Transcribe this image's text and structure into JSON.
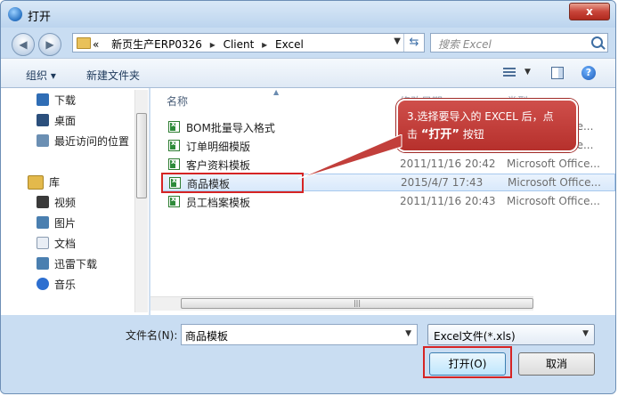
{
  "window": {
    "title": "打开",
    "close_label": "x"
  },
  "address": {
    "back_glyph": "◀",
    "forward_glyph": "▶",
    "prefix": "«",
    "crumbs": [
      "新页生产ERP0326",
      "Client",
      "Excel"
    ],
    "separator": "▸",
    "dropdown_glyph": "▼",
    "refresh_glyph": "⇆"
  },
  "search": {
    "placeholder": "搜索 Excel"
  },
  "toolbar": {
    "organize": "组织 ▾",
    "new_folder": "新建文件夹",
    "view_drop": "▼",
    "help": "?"
  },
  "sidebar": {
    "items": [
      {
        "label": "下载",
        "icon": "download-icon",
        "color": "#2f6db5"
      },
      {
        "label": "桌面",
        "icon": "desktop-icon",
        "color": "#2b4f7c"
      },
      {
        "label": "最近访问的位置",
        "icon": "recent-icon",
        "color": "#6b8fb3"
      }
    ],
    "library_label": "库",
    "library_items": [
      {
        "label": "视频",
        "icon": "video-icon",
        "color": "#3a3a3a"
      },
      {
        "label": "图片",
        "icon": "picture-icon",
        "color": "#4a7fb0"
      },
      {
        "label": "文档",
        "icon": "document-icon",
        "color": "#e9eef5"
      },
      {
        "label": "迅雷下载",
        "icon": "thunder-download-icon",
        "color": "#4a7fb0"
      },
      {
        "label": "音乐",
        "icon": "music-icon",
        "color": "#2d6fd0"
      }
    ]
  },
  "filelist": {
    "col_name": "名称",
    "sort_glyph": "▲",
    "col_date": "修改日期",
    "col_type": "类型",
    "scroll_grip": "|||",
    "rows": [
      {
        "name": "BOM批量导入格式",
        "date": "",
        "type": "",
        "selected": false
      },
      {
        "name": "订单明细模版",
        "date": "",
        "type": "",
        "selected": false
      },
      {
        "name": "客户资料模板",
        "date": "2011/11/16 20:42",
        "type": "Microsoft Office...",
        "selected": false
      },
      {
        "name": "商品模板",
        "date": "2015/4/7 17:43",
        "type": "Microsoft Office...",
        "selected": true
      },
      {
        "name": "员工档案模板",
        "date": "2011/11/16 20:43",
        "type": "Microsoft Office...",
        "selected": false
      }
    ],
    "partial_types": [
      "ce...",
      "ce..."
    ]
  },
  "callout": {
    "line1": "3.选择要导入的 EXCEL 后，点",
    "line2_prefix": "击 ",
    "line2_bold": "“打开”",
    "line2_suffix": " 按钮"
  },
  "footer": {
    "filename_label": "文件名(N):",
    "filename_value": "商品模板",
    "filename_drop": "▼",
    "filter_value": "Excel文件(*.xls)",
    "filter_drop": "▼",
    "open_label": "打开(O)",
    "cancel_label": "取消"
  }
}
